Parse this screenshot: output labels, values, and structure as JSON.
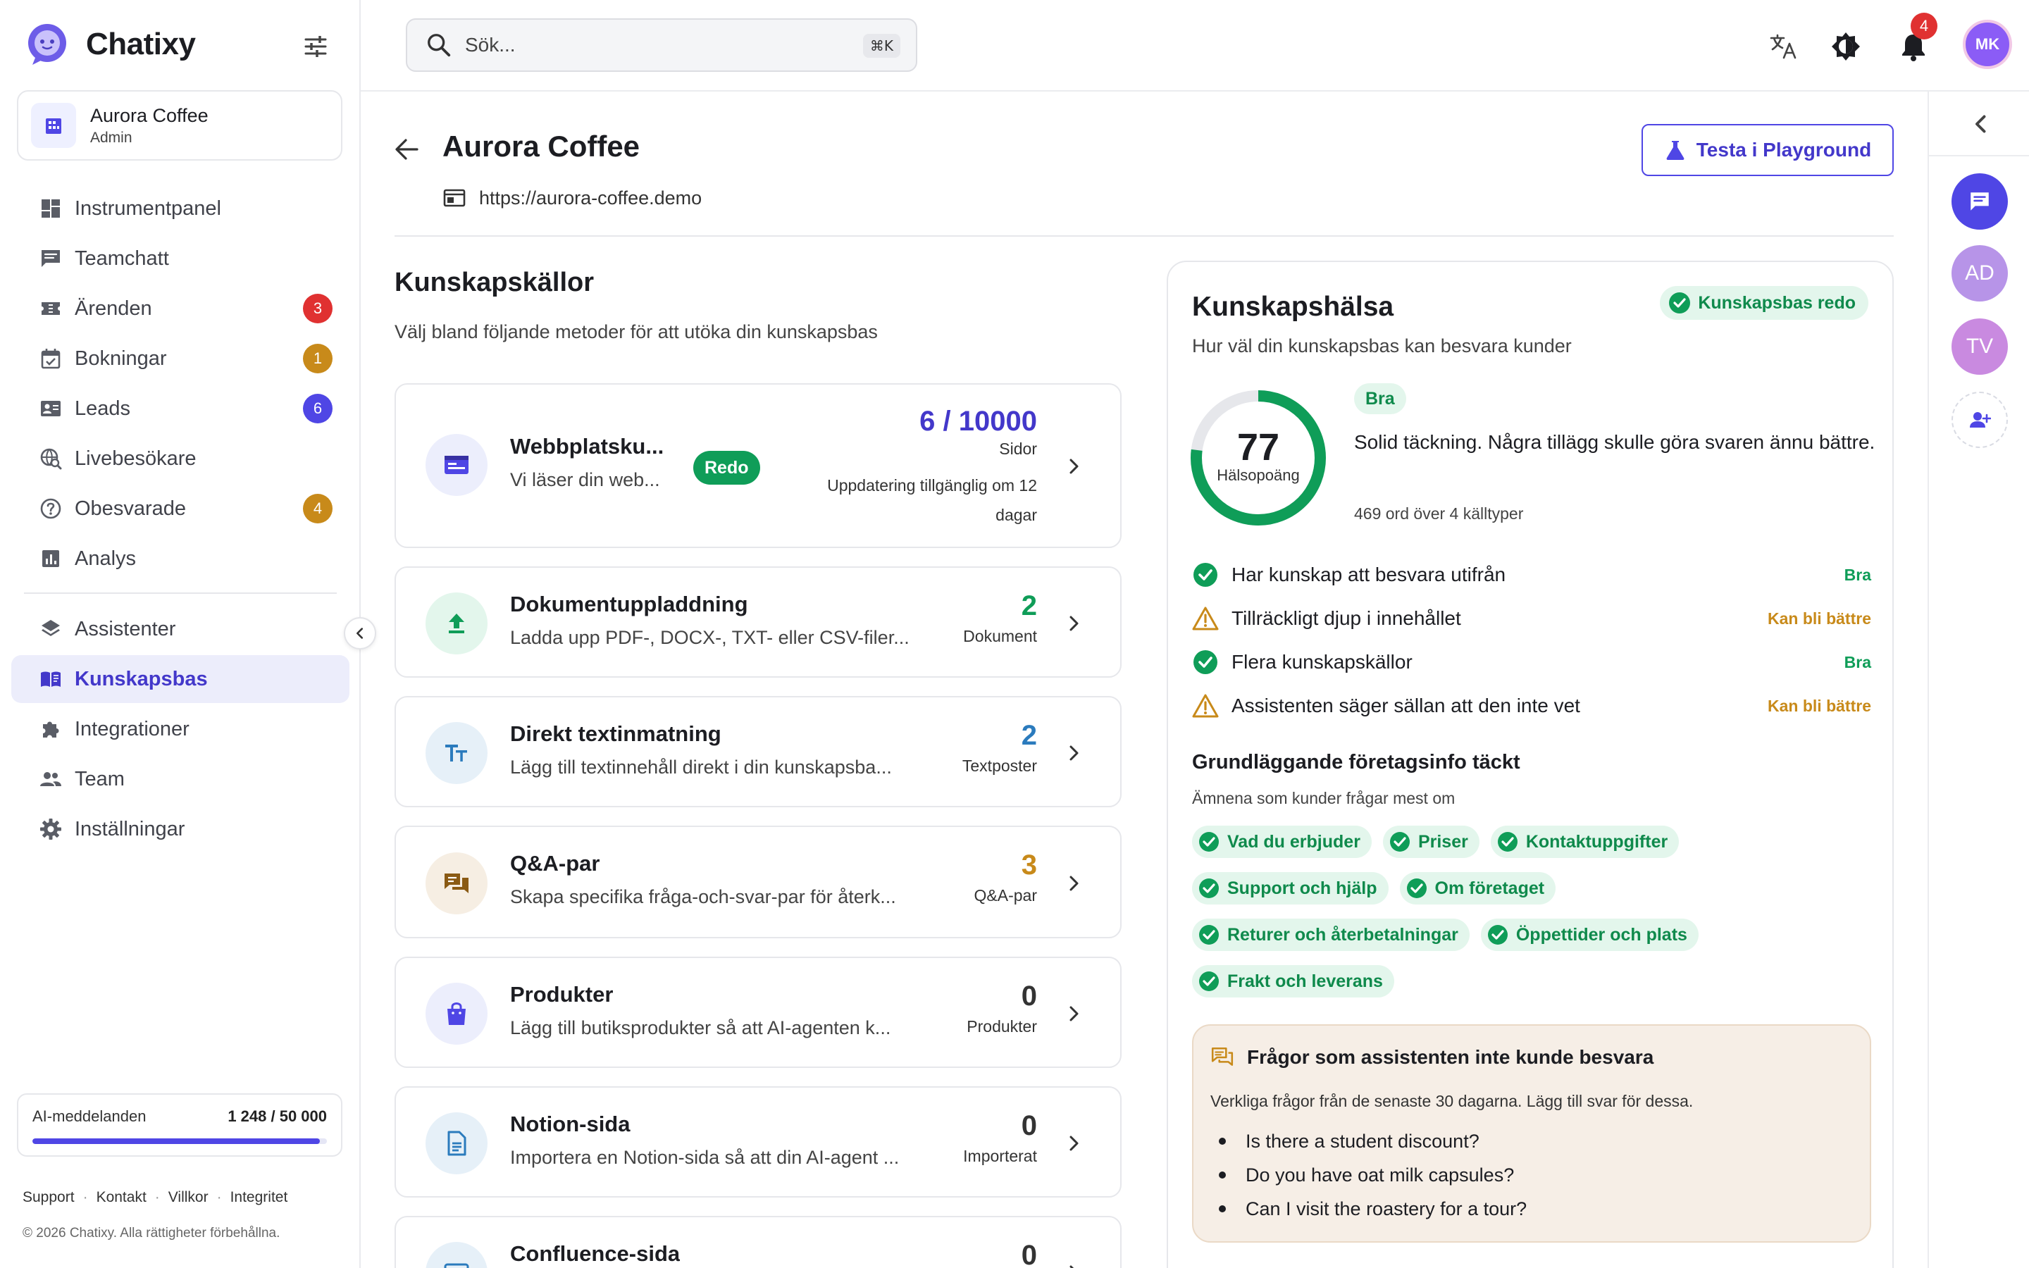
{
  "brand": {
    "name": "Chatixy"
  },
  "org": {
    "name": "Aurora Coffee",
    "role": "Admin"
  },
  "nav": {
    "items": [
      {
        "label": "Instrumentpanel",
        "icon": "dashboard-icon"
      },
      {
        "label": "Teamchatt",
        "icon": "chat-icon"
      },
      {
        "label": "Ärenden",
        "icon": "ticket-icon",
        "badge": "3",
        "badge_color": "#e03131"
      },
      {
        "label": "Bokningar",
        "icon": "calendar-icon",
        "badge": "1",
        "badge_color": "#c88a1a"
      },
      {
        "label": "Leads",
        "icon": "contact-card-icon",
        "badge": "6",
        "badge_color": "#4f46e5"
      },
      {
        "label": "Livebesökare",
        "icon": "live-visitor-icon"
      },
      {
        "label": "Obesvarade",
        "icon": "question-icon",
        "badge": "4",
        "badge_color": "#c88a1a"
      },
      {
        "label": "Analys",
        "icon": "analytics-icon"
      }
    ],
    "items2": [
      {
        "label": "Assistenter",
        "icon": "layers-icon"
      },
      {
        "label": "Kunskapsbas",
        "icon": "book-icon",
        "active": true
      },
      {
        "label": "Integrationer",
        "icon": "puzzle-icon"
      },
      {
        "label": "Team",
        "icon": "people-icon"
      },
      {
        "label": "Inställningar",
        "icon": "gear-icon"
      }
    ]
  },
  "usage": {
    "label": "AI-meddelanden",
    "value": "1 248 / 50 000",
    "fraction": 0.975
  },
  "footer": {
    "links": [
      "Support",
      "Kontakt",
      "Villkor",
      "Integritet"
    ],
    "copyright": "© 2026 Chatixy. Alla rättigheter förbehållna."
  },
  "topbar": {
    "search_placeholder": "Sök...",
    "shortcut": "⌘K",
    "notification_count": "4",
    "user_initials": "MK"
  },
  "rail": {
    "avatars": [
      {
        "initials": "AD",
        "color": "#b794e8"
      },
      {
        "initials": "TV",
        "color": "#c98ae0"
      }
    ]
  },
  "page": {
    "title": "Aurora Coffee",
    "url": "https://aurora-coffee.demo",
    "playground_label": "Testa i Playground"
  },
  "sources": {
    "title": "Kunskapskällor",
    "subtitle": "Välj bland följande metoder för att utöka din kunskapsbas",
    "cards": [
      {
        "title": "Webbplatsku...",
        "desc": "Vi läser din web...",
        "count": "6 / 10000",
        "unit": "Sidor",
        "count_color": "#4338ca",
        "icon": "website-icon",
        "status": "Redo",
        "note": "Uppdatering tillgänglig om 12 dagar"
      },
      {
        "title": "Dokumentuppladdning",
        "desc": "Ladda upp PDF-, DOCX-, TXT- eller CSV-filer...",
        "count": "2",
        "unit": "Dokument",
        "count_color": "#0f9d58",
        "icon": "upload-icon"
      },
      {
        "title": "Direkt textinmatning",
        "desc": "Lägg till textinnehåll direkt i din kunskapsba...",
        "count": "2",
        "unit": "Textposter",
        "count_color": "#2b7bbd",
        "icon": "text-icon"
      },
      {
        "title": "Q&A-par",
        "desc": "Skapa specifika fråga-och-svar-par för återk...",
        "count": "3",
        "unit": "Q&A-par",
        "count_color": "#c88a1a",
        "icon": "qa-icon"
      },
      {
        "title": "Produkter",
        "desc": "Lägg till butiksprodukter så att AI-agenten k...",
        "count": "0",
        "unit": "Produkter",
        "count_color": "#333333",
        "icon": "bag-icon"
      },
      {
        "title": "Notion-sida",
        "desc": "Importera en Notion-sida så att din AI-agent ...",
        "count": "0",
        "unit": "Importerat",
        "count_color": "#333333",
        "icon": "notion-icon"
      },
      {
        "title": "Confluence-sida",
        "desc": "",
        "count": "0",
        "unit": "",
        "count_color": "#333333",
        "icon": "confluence-icon"
      }
    ]
  },
  "health": {
    "title": "Kunskapshälsa",
    "subtitle": "Hur väl din kunskapsbas kan besvara kunder",
    "ready_label": "Kunskapsbas redo",
    "score": "77",
    "score_value": 77,
    "score_label": "Hälsopoäng",
    "rating": "Bra",
    "summary": "Solid täckning. Några tillägg skulle göra svaren ännu bättre.",
    "meta": "469 ord över 4 källtyper",
    "checks": [
      {
        "label": "Har kunskap att besvara utifrån",
        "status": "Bra",
        "ok": true
      },
      {
        "label": "Tillräckligt djup i innehållet",
        "status": "Kan bli bättre",
        "ok": false
      },
      {
        "label": "Flera kunskapskällor",
        "status": "Bra",
        "ok": true
      },
      {
        "label": "Assistenten säger sällan att den inte vet",
        "status": "Kan bli bättre",
        "ok": false
      }
    ],
    "basic_title": "Grundläggande företagsinfo täckt",
    "basic_sub": "Ämnena som kunder frågar mest om",
    "topics": [
      [
        "Vad du erbjuder",
        "Priser",
        "Kontaktuppgifter"
      ],
      [
        "Support och hjälp",
        "Om företaget"
      ],
      [
        "Returer och återbetalningar",
        "Öppettider och plats"
      ],
      [
        "Frakt och leverans"
      ]
    ],
    "unanswered": {
      "title": "Frågor som assistenten inte kunde besvara",
      "subtitle": "Verkliga frågor från de senaste 30 dagarna. Lägg till svar för dessa.",
      "questions": [
        "Is there a student discount?",
        "Do you have oat milk capsules?",
        "Can I visit the roastery for a tour?"
      ]
    }
  },
  "colors": {
    "accent": "#4f46e5",
    "success": "#0f9d58",
    "warning": "#c88a1a",
    "danger": "#e03131"
  }
}
